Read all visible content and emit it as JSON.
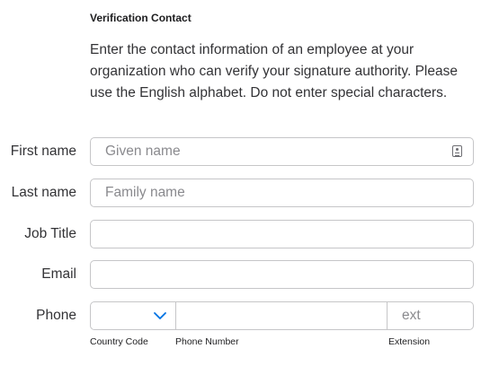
{
  "section": {
    "title": "Verification Contact",
    "description": "Enter the contact information of an employee at your organization who can verify your signature authority. Please use the English alphabet. Do not enter special characters."
  },
  "fields": {
    "first_name": {
      "label": "First name",
      "placeholder": "Given name",
      "value": ""
    },
    "last_name": {
      "label": "Last name",
      "placeholder": "Family name",
      "value": ""
    },
    "job_title": {
      "label": "Job Title",
      "placeholder": "",
      "value": ""
    },
    "email": {
      "label": "Email",
      "placeholder": "",
      "value": ""
    },
    "phone": {
      "label": "Phone",
      "country_code": {
        "sublabel": "Country Code",
        "selected": ""
      },
      "number": {
        "sublabel": "Phone Number",
        "placeholder": "",
        "value": ""
      },
      "extension": {
        "sublabel": "Extension",
        "placeholder": "ext",
        "value": ""
      }
    }
  },
  "icons": {
    "autofill": "contact-card-icon",
    "dropdown": "chevron-down-icon"
  },
  "colors": {
    "border": "#c6c6c8",
    "placeholder": "#8a8a8e",
    "chevron": "#0071e3",
    "text": "#333336"
  }
}
